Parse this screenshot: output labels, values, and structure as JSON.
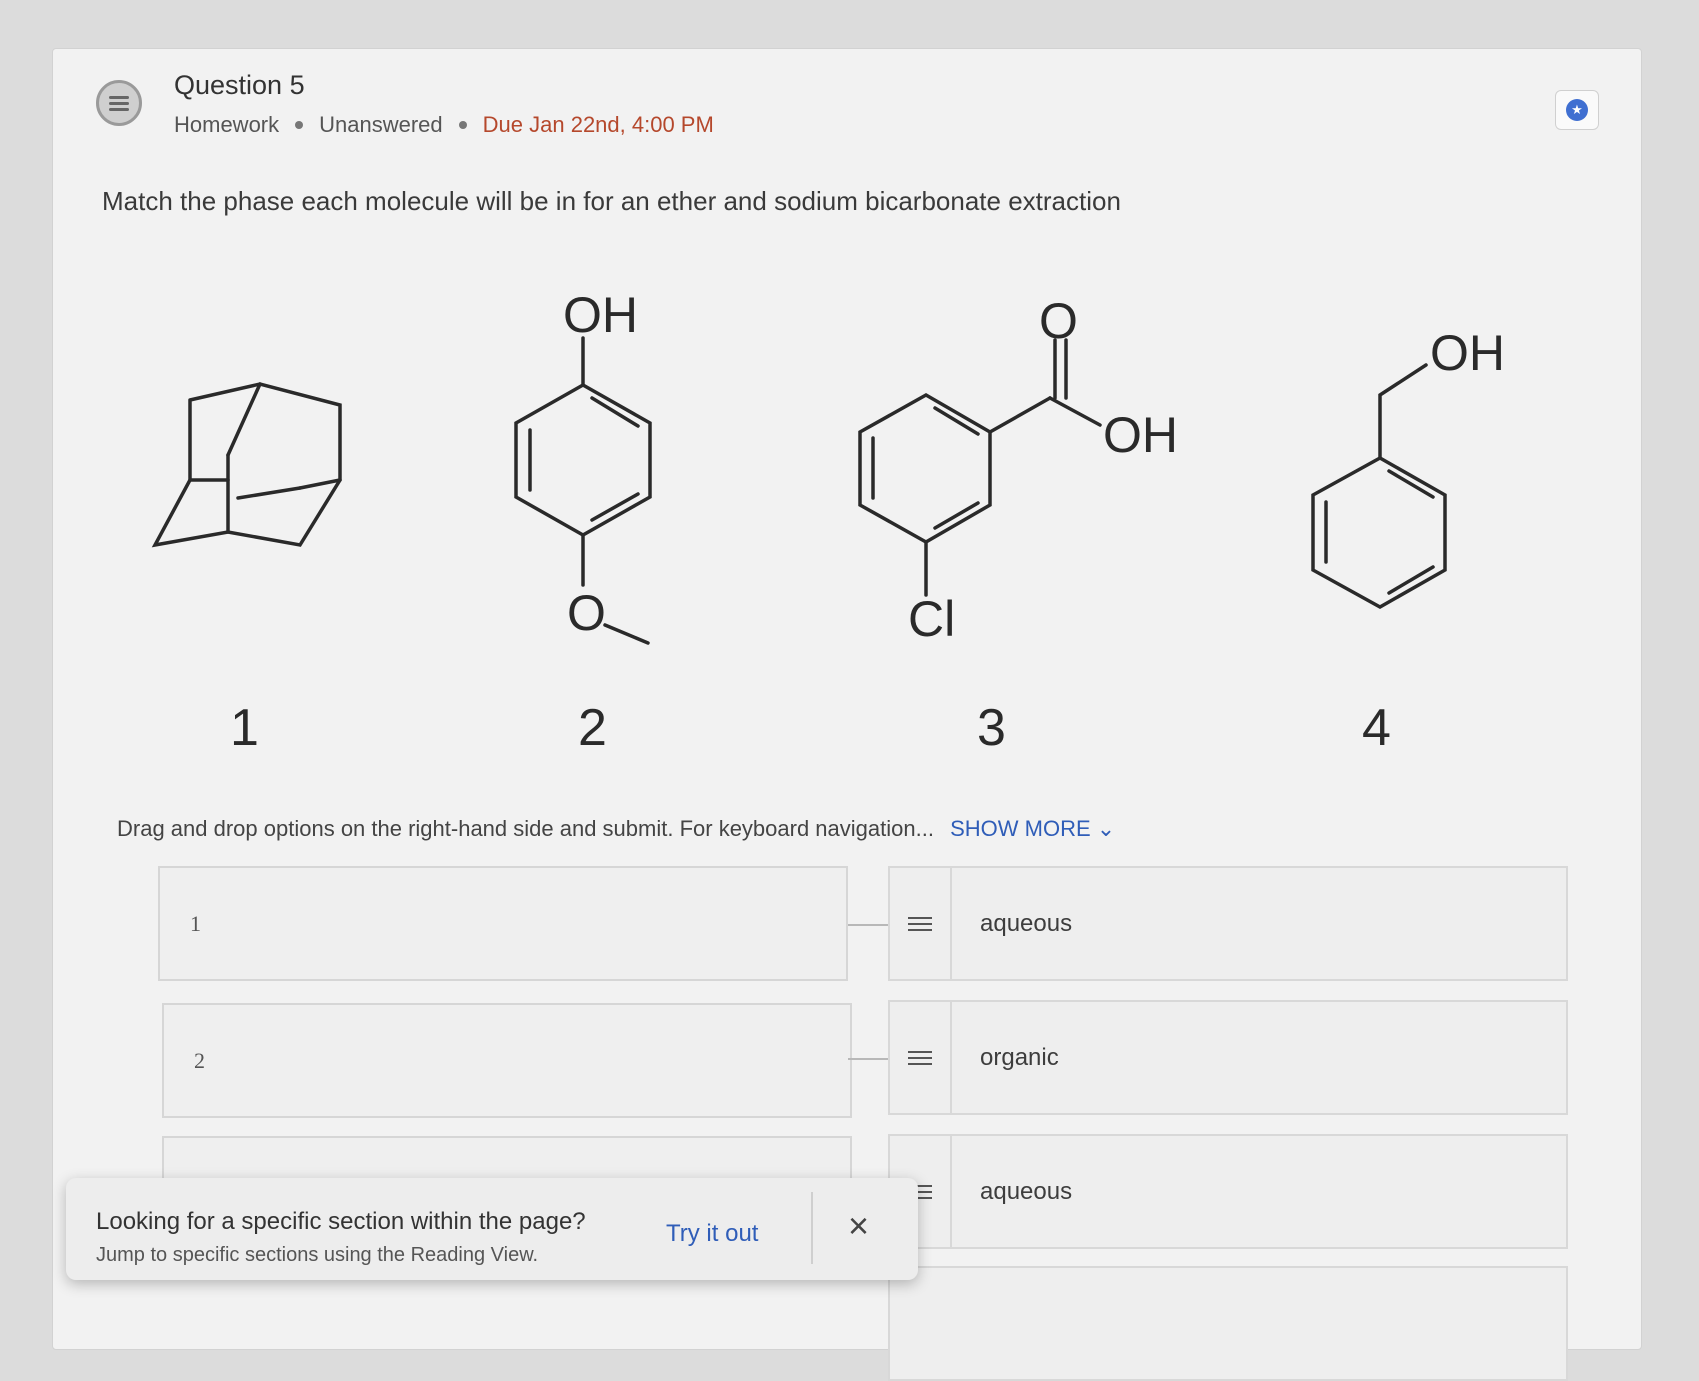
{
  "question": {
    "title": "Question 5",
    "type": "Homework",
    "status": "Unanswered",
    "due": "Due Jan 22nd, 4:00 PM",
    "prompt": "Match the phase each molecule will be in for an ether and sodium bicarbonate extraction"
  },
  "molecules": {
    "labels": [
      "1",
      "2",
      "3",
      "4"
    ],
    "atom_oh": "OH",
    "atom_o": "O",
    "atom_cl": "Cl"
  },
  "instructions": {
    "text": "Drag and drop options on the right-hand side and submit. For keyboard navigation...",
    "show_more": "SHOW MORE"
  },
  "targets": [
    "1",
    "2"
  ],
  "options": [
    "aqueous",
    "organic",
    "aqueous"
  ],
  "toast": {
    "title": "Looking for a specific section within the page?",
    "subtitle": "Jump to specific sections using the Reading View.",
    "action": "Try it out",
    "close": "×"
  },
  "icons": {
    "question": "question-list-icon",
    "star": "star-icon",
    "drag": "drag-handle-icon",
    "chevron": "chevron-down-icon",
    "close": "close-icon"
  },
  "colors": {
    "link": "#2f5db8",
    "due": "#b5482c",
    "star": "#3f6fd1"
  }
}
